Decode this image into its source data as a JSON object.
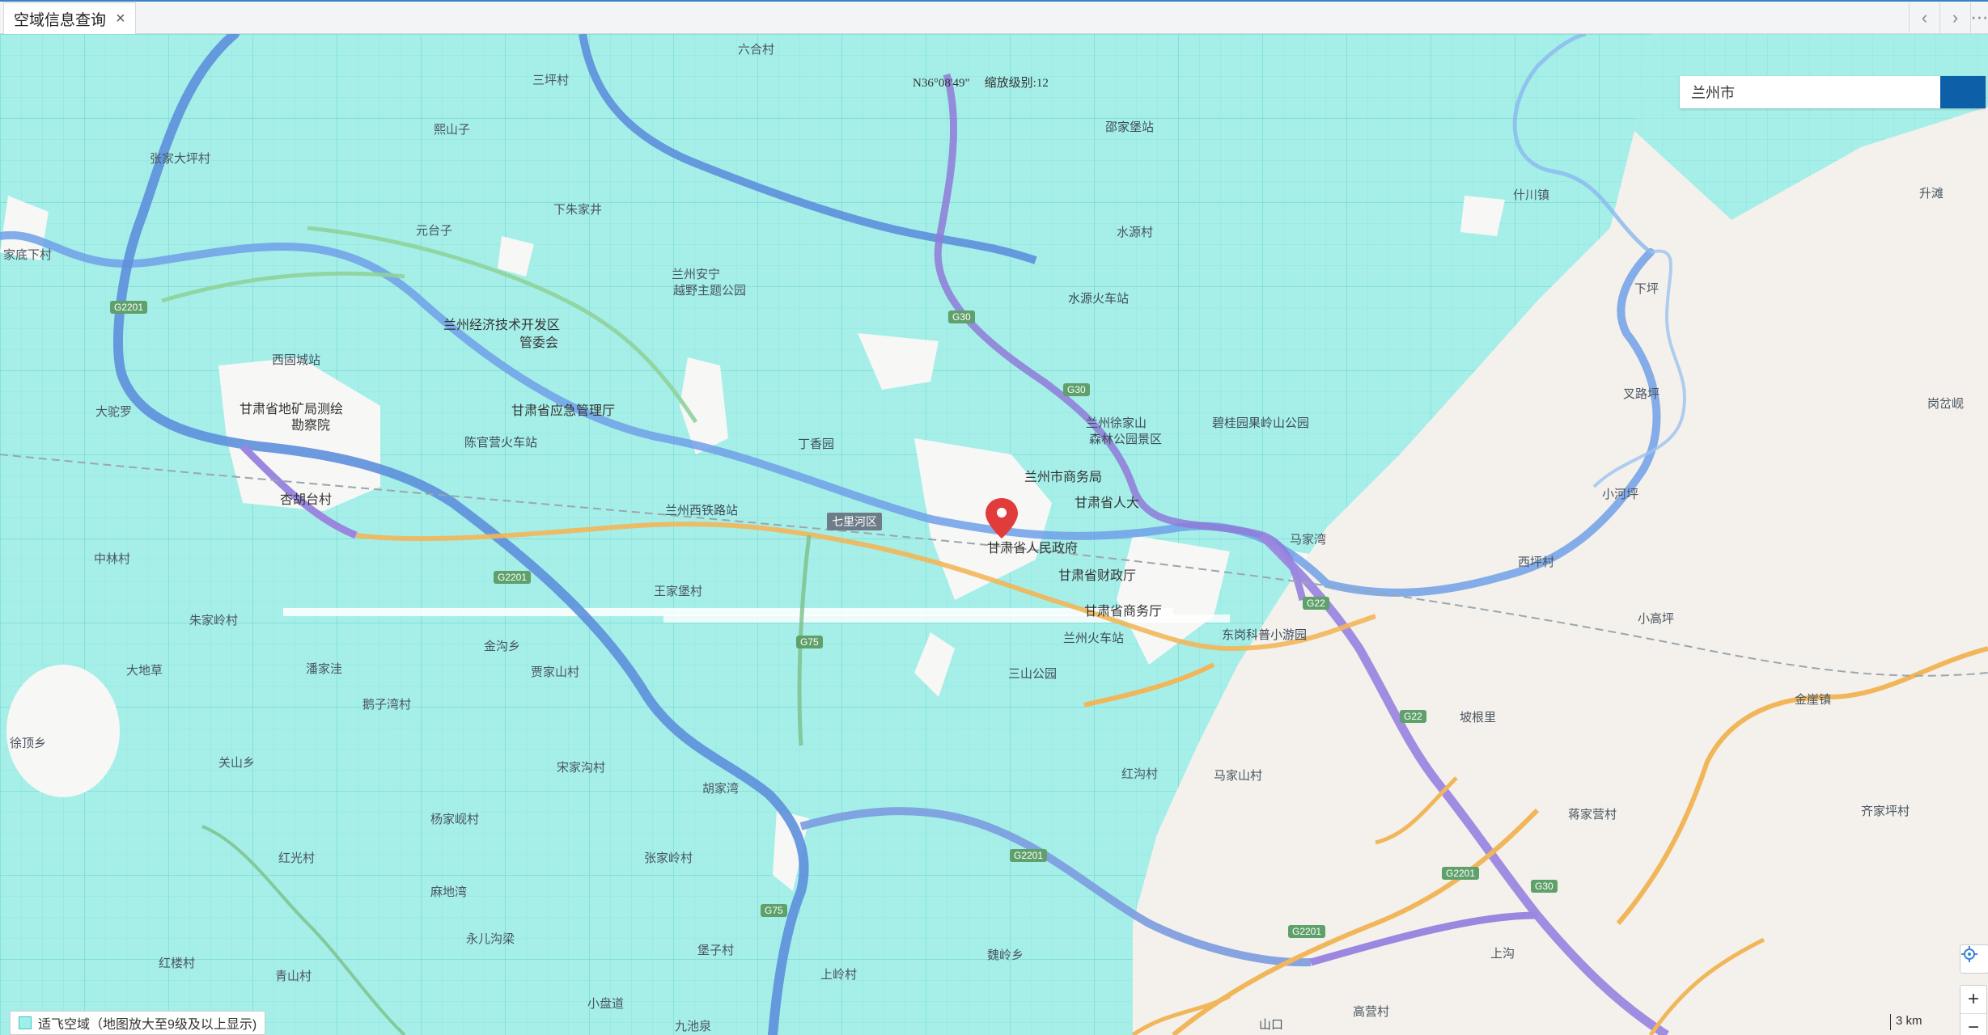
{
  "tab": {
    "title": "空域信息查询",
    "close": "×"
  },
  "nav": {
    "prev": "‹",
    "next": "›",
    "more": "⋯"
  },
  "map": {
    "coordinate": "N36°08'49\"",
    "zoom_text": "缩放级别:12",
    "search_value": "兰州市",
    "zoom_in": "+",
    "zoom_out": "−",
    "legend_text": "适飞空域（地图放大至9级及以上显示)",
    "scale_text": "3 km",
    "colors": {
      "airspace": "#a6efe9",
      "highway": "#9b86e0",
      "arterial": "#f2b65a",
      "river": "#6fa0e8"
    },
    "places": [
      "六合村",
      "三坪村",
      "熙山子",
      "张家大坪村",
      "下朱家井",
      "元台子",
      "兰州安宁",
      "越野主题公园",
      "兰州经济技术开发区",
      "管委会",
      "西固城站",
      "甘肃省地矿局测绘",
      "勘察院",
      "大驼罗",
      "杏胡台村",
      "陈官营火车站",
      "甘肃省应急管理厅",
      "丁香园",
      "兰州市商务局",
      "甘肃省人大",
      "甘肃省人民政府",
      "甘肃省财政厅",
      "甘肃省商务厅",
      "兰州西铁路站",
      "七里河区",
      "兰州火车站",
      "东岗科普小游园",
      "三山公园",
      "王家堡村",
      "中林村",
      "朱家岭村",
      "金沟乡",
      "贾家山村",
      "大地草",
      "潘家洼",
      "鹅子湾村",
      "徐顶乡",
      "关山乡",
      "宋家沟村",
      "杨家岘村",
      "胡家湾",
      "红光村",
      "张家岭村",
      "麻地湾",
      "永儿沟梁",
      "堡子村",
      "红楼村",
      "青山村",
      "小盘道",
      "九池泉",
      "上岭村",
      "魏岭乡",
      "红沟村",
      "马家山村",
      "邵家堡站",
      "水源村",
      "水源火车站",
      "碧桂园果岭山公园",
      "兰州徐家山",
      "森林公园景区",
      "马家湾",
      "西坪村",
      "小高坪",
      "坡根里",
      "蒋家营村",
      "金崖镇",
      "齐家坪村",
      "上沟",
      "山口",
      "高营村",
      "什川镇",
      "下坪",
      "叉路坪",
      "小河坪",
      "岗岔岘",
      "升滩",
      "家底下村"
    ],
    "road_shields": [
      "G2201",
      "G2201",
      "G30",
      "G30",
      "G22",
      "G22",
      "G75",
      "G75",
      "G2201",
      "G2201",
      "G2201",
      "G30"
    ]
  }
}
